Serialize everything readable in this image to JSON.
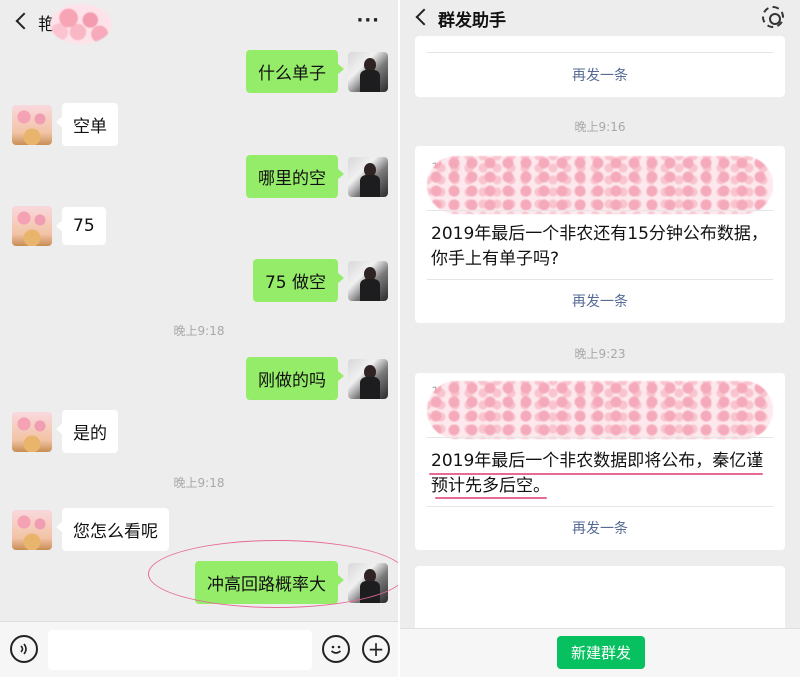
{
  "left_chat": {
    "title": "艳",
    "messages": [
      {
        "side": "right",
        "text": "什么单子"
      },
      {
        "side": "left",
        "text": "空单"
      },
      {
        "side": "right",
        "text": "哪里的空"
      },
      {
        "side": "left",
        "text": "75"
      },
      {
        "side": "right",
        "text": "75 做空"
      },
      {
        "side": "time",
        "text": "晚上9:18"
      },
      {
        "side": "right",
        "text": "刚做的吗"
      },
      {
        "side": "left",
        "text": "是的"
      },
      {
        "side": "time",
        "text": "晚上9:18"
      },
      {
        "side": "left",
        "text": "您怎么看呢"
      },
      {
        "side": "right",
        "text": "冲高回路概率大"
      }
    ],
    "icons": {
      "back": "chevron-left-icon",
      "more": "more-dots-icon",
      "voice": "voice-icon",
      "emoji": "emoji-icon",
      "add": "plus-icon"
    }
  },
  "right_panel": {
    "title": "群发助手",
    "resend_label": "再发一条",
    "cards": [
      {
        "time": "",
        "faint": "",
        "body": ""
      },
      {
        "time": "晚上9:16",
        "faint": "140位",
        "body": "2019年最后一个非农还有15分钟公布数据，你手上有单子吗?"
      },
      {
        "time": "晚上9:23",
        "faint": "1",
        "body": "2019年最后一个非农数据即将公布，秦亿谨预计先多后空。"
      }
    ],
    "new_button": "新建群发",
    "icons": {
      "back": "chevron-left-icon",
      "settings": "gear-icon"
    }
  },
  "colors": {
    "green_bubble": "#95ec69",
    "accent_green": "#07c160",
    "link_blue": "#576b95",
    "highlight_pink": "#e56a95"
  }
}
